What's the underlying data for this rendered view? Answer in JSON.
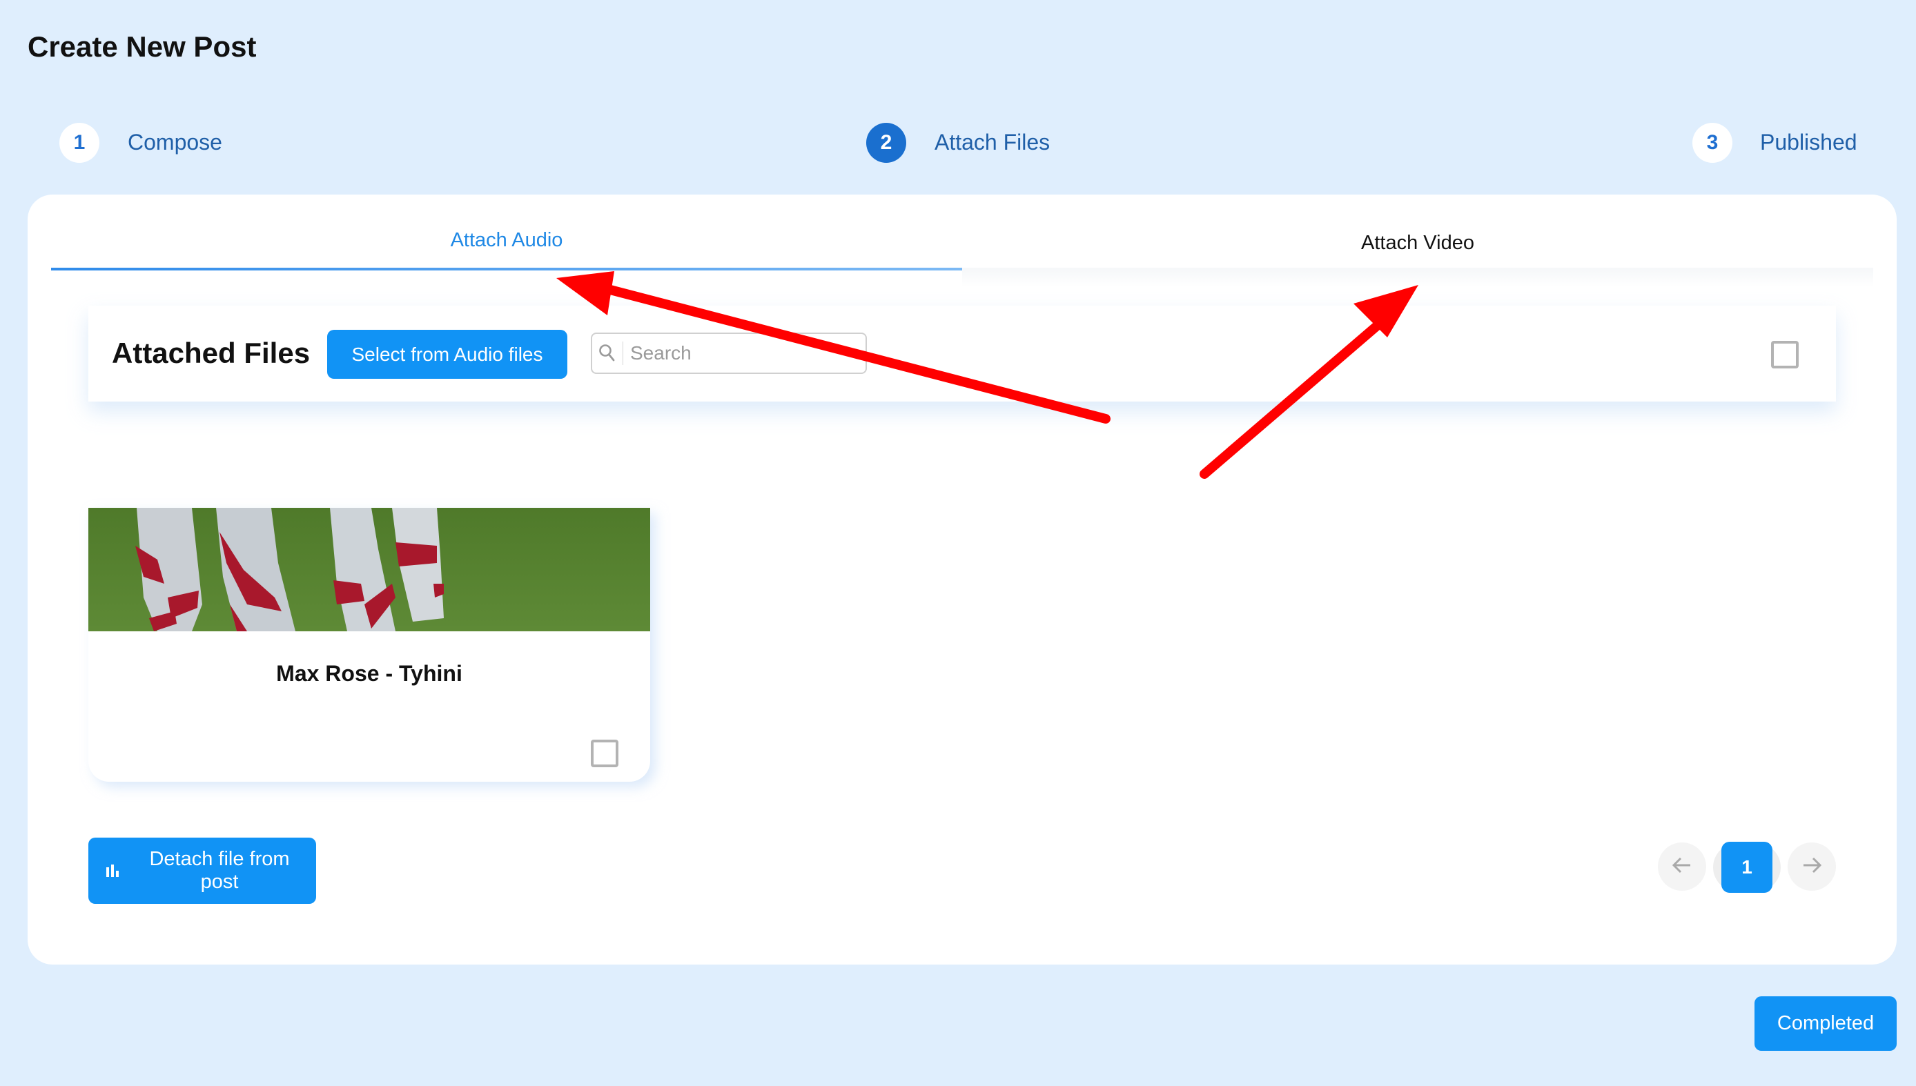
{
  "page": {
    "title": "Create New Post"
  },
  "stepper": {
    "steps": [
      {
        "number": "1",
        "label": "Compose",
        "state": "done"
      },
      {
        "number": "2",
        "label": "Attach Files",
        "state": "active"
      },
      {
        "number": "3",
        "label": "Published",
        "state": "pending"
      }
    ]
  },
  "tabs": [
    {
      "label": "Attach Audio",
      "selected": true
    },
    {
      "label": "Attach Video",
      "selected": false
    }
  ],
  "attached_files": {
    "title": "Attached Files",
    "select_button_label": "Select from Audio files",
    "search": {
      "placeholder": "Search",
      "value": ""
    },
    "select_all_checked": false,
    "items": [
      {
        "name": "Max Rose - Tyhini",
        "checked": false,
        "thumbnail": "photo of figures in white robes with red stripes on grass"
      }
    ]
  },
  "actions": {
    "detach_label": "Detach file from post",
    "completed_label": "Completed"
  },
  "pagination": {
    "current_page": "1",
    "prev_icon": "arrow-left-icon",
    "next_icon": "arrow-right-icon"
  },
  "colors": {
    "background": "#dfeefd",
    "primary": "#1193f5",
    "step_active": "#1a6fcf",
    "annotation_arrow": "#ff0000"
  }
}
